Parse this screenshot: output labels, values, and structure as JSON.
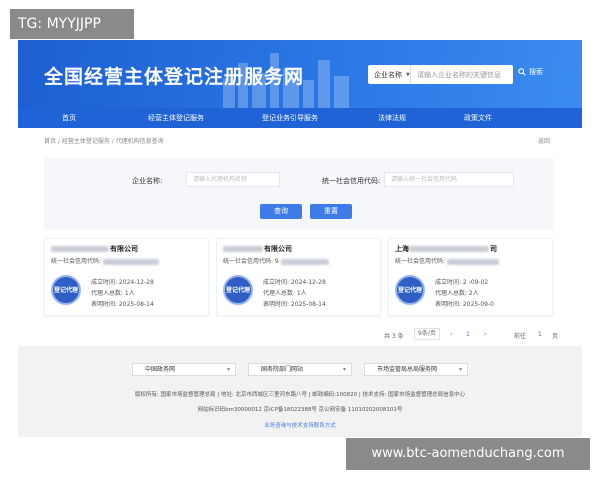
{
  "overlay": {
    "tag": "TG: MYYJJPP",
    "watermark": "www.btc-aomenduchang.com"
  },
  "header": {
    "title": "全国经营主体登记注册服务网",
    "search_category": "企业名称",
    "search_placeholder": "请输入企业名称的关键信息",
    "search_button": "搜索"
  },
  "nav": {
    "items": [
      "首页",
      "经营主体登记服务",
      "登记业务引导服务",
      "法律法规",
      "政策文件"
    ]
  },
  "breadcrumb": "首页 / 经营主体登记服务 / 代理机构信息查询",
  "back_label": "返回",
  "form": {
    "company_label": "企业名称:",
    "company_placeholder": "请输入代理机构名称",
    "credit_label": "统一社会信用代码:",
    "credit_placeholder": "请输入统一社会信用代码",
    "query_button": "查询",
    "reset_button": "重置"
  },
  "cards": [
    {
      "name_suffix": "有限公司",
      "code_label": "统一社会信用代码:",
      "seal": "登记代理",
      "founded": "成立时间:  2024-12-28",
      "agents": "代理人总数:  1人",
      "expires": "表明时间:  2025-08-14"
    },
    {
      "name_suffix": "有限公司",
      "code_label": "统一社会信用代码:  9",
      "seal": "登记代理",
      "founded": "成立时间:  2024-12-28",
      "agents": "代理人总数:  1人",
      "expires": "表明时间:  2025-08-14"
    },
    {
      "name_prefix": "上海",
      "name_suffix": "司",
      "code_label": "统一社会信用代码:",
      "seal": "登记代理",
      "founded": "成立时间:  2  -09-02",
      "agents": "代理人总数:  2人",
      "expires": "表明时间:  2025-09-0"
    }
  ],
  "pagination": {
    "total": "共 3 条",
    "page_size": "9条/页",
    "prev": "‹",
    "page": "1",
    "next": "›",
    "goto": "前往",
    "goto_value": "1",
    "unit": "页"
  },
  "footer": {
    "selects": [
      "中国政务网",
      "国务院部门网站",
      "市场监管局总局服务网"
    ],
    "line1": "版权所有: 国家市场监督管理总局 | 地址: 北京市西城区三里河东路八号 | 邮政编码:100820 | 技术支持: 国家市场监督管理总局信息中心",
    "line2": "网站标识码bm30000012  京ICP备18022388号  京公网安备 11010202008101号",
    "line3": "业务咨询与技术支持联系方式"
  },
  "colors": {
    "banner": "#1d5fd0",
    "nav": "#1f63d6",
    "button": "#3d7be8",
    "seal": "#2f5fc4"
  }
}
